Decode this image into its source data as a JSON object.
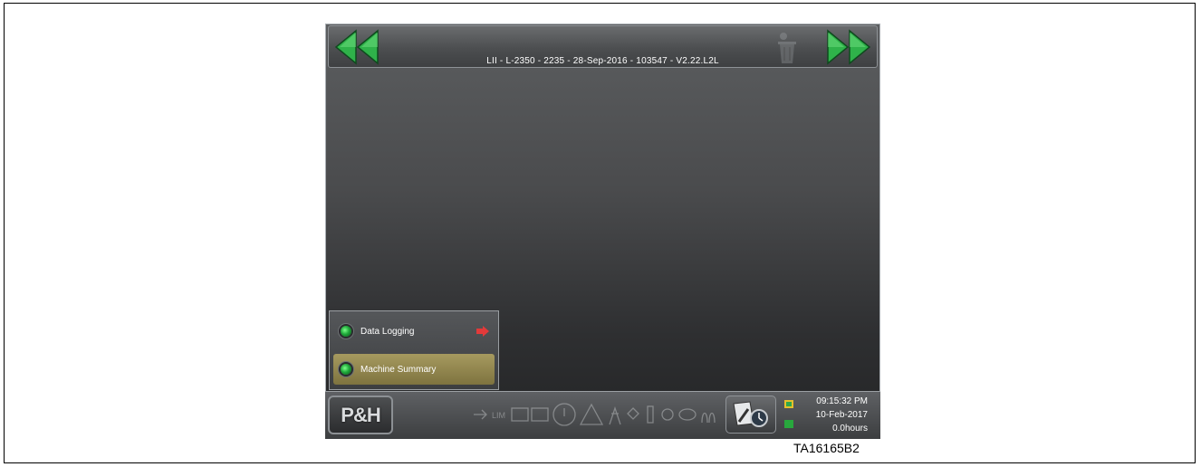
{
  "header": {
    "title": "LII - L-2350 - 2235 - 28-Sep-2016 - 103547 - V2.22.L2L"
  },
  "nav": {
    "back_icon": "double-left-arrow",
    "forward_icon": "double-right-arrow",
    "trash_icon": "trash-icon"
  },
  "popup_menu": {
    "items": [
      {
        "label": "Data Logging",
        "indicator": "green",
        "arrow": "red-right-arrow"
      },
      {
        "label": "Machine Summary",
        "indicator": "green",
        "selected": true
      }
    ]
  },
  "footer": {
    "logo": "P&H",
    "time": "09:15:32 PM",
    "date": "10-Feb-2017",
    "hours": "0.0hours"
  },
  "figure_label": "TA16165B2",
  "colors": {
    "accent_green": "#1fa83a",
    "selected_item": "#a69a5f",
    "arrow_red": "#e23a3a"
  }
}
